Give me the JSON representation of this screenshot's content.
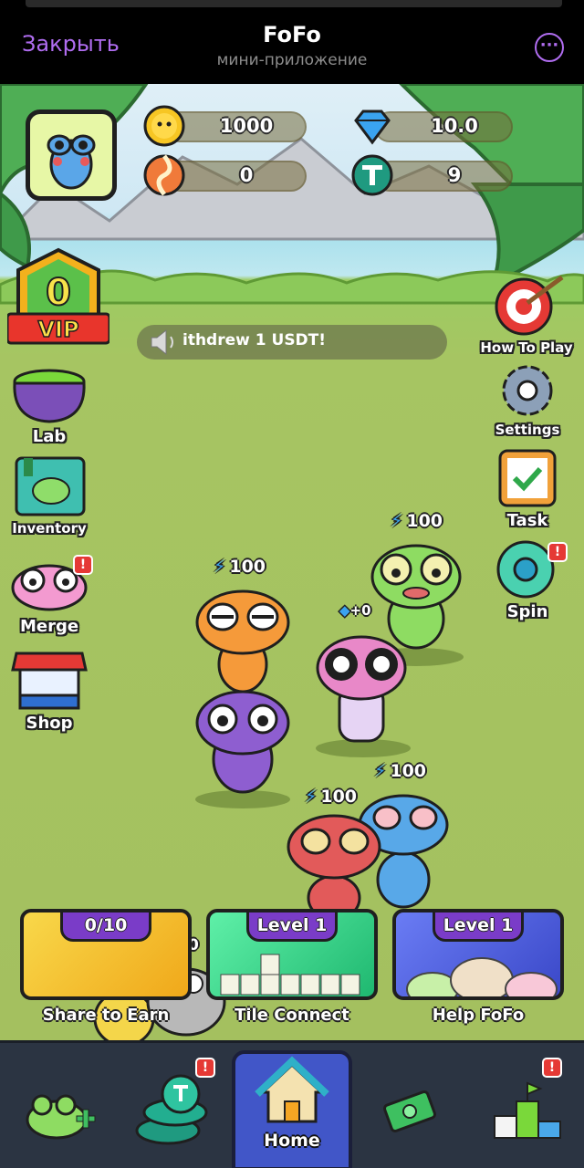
{
  "telegram": {
    "close_label": "Закрыть",
    "title": "FoFo",
    "subtitle": "мини-приложение",
    "more_label": "···"
  },
  "resources": {
    "coins": "1000",
    "gems": "10.0",
    "candy": "0",
    "usdt": "9"
  },
  "vip": {
    "level": "0",
    "label": "VIP"
  },
  "ticker": {
    "text": "ithdrew 1 USDT!"
  },
  "left_menu": {
    "lab": "Lab",
    "inventory": "Inventory",
    "merge": "Merge",
    "shop": "Shop"
  },
  "right_menu": {
    "how_to_play": "How To Play",
    "settings": "Settings",
    "task": "Task",
    "spin": "Spin"
  },
  "frogs": {
    "green_energy": "100",
    "orange_energy": "100",
    "pink_gem": "+0",
    "red_energy": "100",
    "blue_energy": "100"
  },
  "cards": [
    {
      "badge": "0/10",
      "label": "Share to Earn",
      "color": "#f3c21c"
    },
    {
      "badge": "Level 1",
      "label": "Tile Connect",
      "color": "#32d187"
    },
    {
      "badge": "Level 1",
      "label": "Help FoFo",
      "color": "#4256e0"
    }
  ],
  "partial_text": "0",
  "nav": {
    "home_label": "Home",
    "badge_mark": "!"
  },
  "colors": {
    "accent": "#b06df0",
    "nav_bg": "#2b3442",
    "home_bg": "#4156c8",
    "grass": "#a4c05f"
  }
}
